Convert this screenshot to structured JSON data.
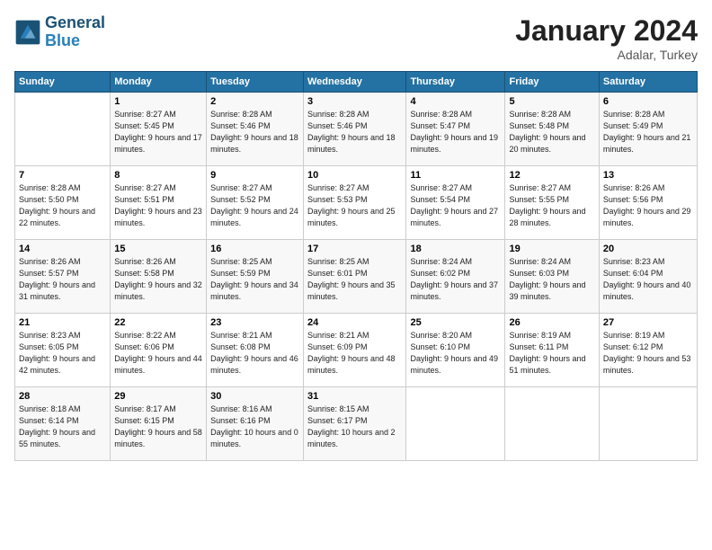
{
  "logo": {
    "line1": "General",
    "line2": "Blue"
  },
  "title": "January 2024",
  "subtitle": "Adalar, Turkey",
  "header_days": [
    "Sunday",
    "Monday",
    "Tuesday",
    "Wednesday",
    "Thursday",
    "Friday",
    "Saturday"
  ],
  "weeks": [
    [
      {
        "num": "",
        "sunrise": "",
        "sunset": "",
        "daylight": ""
      },
      {
        "num": "1",
        "sunrise": "Sunrise: 8:27 AM",
        "sunset": "Sunset: 5:45 PM",
        "daylight": "Daylight: 9 hours and 17 minutes."
      },
      {
        "num": "2",
        "sunrise": "Sunrise: 8:28 AM",
        "sunset": "Sunset: 5:46 PM",
        "daylight": "Daylight: 9 hours and 18 minutes."
      },
      {
        "num": "3",
        "sunrise": "Sunrise: 8:28 AM",
        "sunset": "Sunset: 5:46 PM",
        "daylight": "Daylight: 9 hours and 18 minutes."
      },
      {
        "num": "4",
        "sunrise": "Sunrise: 8:28 AM",
        "sunset": "Sunset: 5:47 PM",
        "daylight": "Daylight: 9 hours and 19 minutes."
      },
      {
        "num": "5",
        "sunrise": "Sunrise: 8:28 AM",
        "sunset": "Sunset: 5:48 PM",
        "daylight": "Daylight: 9 hours and 20 minutes."
      },
      {
        "num": "6",
        "sunrise": "Sunrise: 8:28 AM",
        "sunset": "Sunset: 5:49 PM",
        "daylight": "Daylight: 9 hours and 21 minutes."
      }
    ],
    [
      {
        "num": "7",
        "sunrise": "Sunrise: 8:28 AM",
        "sunset": "Sunset: 5:50 PM",
        "daylight": "Daylight: 9 hours and 22 minutes."
      },
      {
        "num": "8",
        "sunrise": "Sunrise: 8:27 AM",
        "sunset": "Sunset: 5:51 PM",
        "daylight": "Daylight: 9 hours and 23 minutes."
      },
      {
        "num": "9",
        "sunrise": "Sunrise: 8:27 AM",
        "sunset": "Sunset: 5:52 PM",
        "daylight": "Daylight: 9 hours and 24 minutes."
      },
      {
        "num": "10",
        "sunrise": "Sunrise: 8:27 AM",
        "sunset": "Sunset: 5:53 PM",
        "daylight": "Daylight: 9 hours and 25 minutes."
      },
      {
        "num": "11",
        "sunrise": "Sunrise: 8:27 AM",
        "sunset": "Sunset: 5:54 PM",
        "daylight": "Daylight: 9 hours and 27 minutes."
      },
      {
        "num": "12",
        "sunrise": "Sunrise: 8:27 AM",
        "sunset": "Sunset: 5:55 PM",
        "daylight": "Daylight: 9 hours and 28 minutes."
      },
      {
        "num": "13",
        "sunrise": "Sunrise: 8:26 AM",
        "sunset": "Sunset: 5:56 PM",
        "daylight": "Daylight: 9 hours and 29 minutes."
      }
    ],
    [
      {
        "num": "14",
        "sunrise": "Sunrise: 8:26 AM",
        "sunset": "Sunset: 5:57 PM",
        "daylight": "Daylight: 9 hours and 31 minutes."
      },
      {
        "num": "15",
        "sunrise": "Sunrise: 8:26 AM",
        "sunset": "Sunset: 5:58 PM",
        "daylight": "Daylight: 9 hours and 32 minutes."
      },
      {
        "num": "16",
        "sunrise": "Sunrise: 8:25 AM",
        "sunset": "Sunset: 5:59 PM",
        "daylight": "Daylight: 9 hours and 34 minutes."
      },
      {
        "num": "17",
        "sunrise": "Sunrise: 8:25 AM",
        "sunset": "Sunset: 6:01 PM",
        "daylight": "Daylight: 9 hours and 35 minutes."
      },
      {
        "num": "18",
        "sunrise": "Sunrise: 8:24 AM",
        "sunset": "Sunset: 6:02 PM",
        "daylight": "Daylight: 9 hours and 37 minutes."
      },
      {
        "num": "19",
        "sunrise": "Sunrise: 8:24 AM",
        "sunset": "Sunset: 6:03 PM",
        "daylight": "Daylight: 9 hours and 39 minutes."
      },
      {
        "num": "20",
        "sunrise": "Sunrise: 8:23 AM",
        "sunset": "Sunset: 6:04 PM",
        "daylight": "Daylight: 9 hours and 40 minutes."
      }
    ],
    [
      {
        "num": "21",
        "sunrise": "Sunrise: 8:23 AM",
        "sunset": "Sunset: 6:05 PM",
        "daylight": "Daylight: 9 hours and 42 minutes."
      },
      {
        "num": "22",
        "sunrise": "Sunrise: 8:22 AM",
        "sunset": "Sunset: 6:06 PM",
        "daylight": "Daylight: 9 hours and 44 minutes."
      },
      {
        "num": "23",
        "sunrise": "Sunrise: 8:21 AM",
        "sunset": "Sunset: 6:08 PM",
        "daylight": "Daylight: 9 hours and 46 minutes."
      },
      {
        "num": "24",
        "sunrise": "Sunrise: 8:21 AM",
        "sunset": "Sunset: 6:09 PM",
        "daylight": "Daylight: 9 hours and 48 minutes."
      },
      {
        "num": "25",
        "sunrise": "Sunrise: 8:20 AM",
        "sunset": "Sunset: 6:10 PM",
        "daylight": "Daylight: 9 hours and 49 minutes."
      },
      {
        "num": "26",
        "sunrise": "Sunrise: 8:19 AM",
        "sunset": "Sunset: 6:11 PM",
        "daylight": "Daylight: 9 hours and 51 minutes."
      },
      {
        "num": "27",
        "sunrise": "Sunrise: 8:19 AM",
        "sunset": "Sunset: 6:12 PM",
        "daylight": "Daylight: 9 hours and 53 minutes."
      }
    ],
    [
      {
        "num": "28",
        "sunrise": "Sunrise: 8:18 AM",
        "sunset": "Sunset: 6:14 PM",
        "daylight": "Daylight: 9 hours and 55 minutes."
      },
      {
        "num": "29",
        "sunrise": "Sunrise: 8:17 AM",
        "sunset": "Sunset: 6:15 PM",
        "daylight": "Daylight: 9 hours and 58 minutes."
      },
      {
        "num": "30",
        "sunrise": "Sunrise: 8:16 AM",
        "sunset": "Sunset: 6:16 PM",
        "daylight": "Daylight: 10 hours and 0 minutes."
      },
      {
        "num": "31",
        "sunrise": "Sunrise: 8:15 AM",
        "sunset": "Sunset: 6:17 PM",
        "daylight": "Daylight: 10 hours and 2 minutes."
      },
      {
        "num": "",
        "sunrise": "",
        "sunset": "",
        "daylight": ""
      },
      {
        "num": "",
        "sunrise": "",
        "sunset": "",
        "daylight": ""
      },
      {
        "num": "",
        "sunrise": "",
        "sunset": "",
        "daylight": ""
      }
    ]
  ]
}
